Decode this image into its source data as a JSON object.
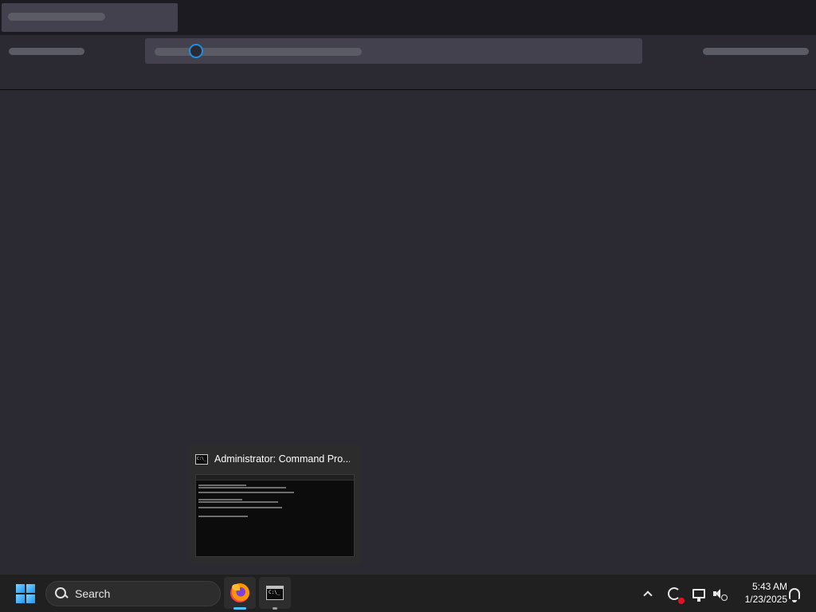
{
  "taskbar": {
    "search_label": "Search",
    "apps": [
      {
        "name": "Firefox",
        "icon": "firefox-icon",
        "active": true
      },
      {
        "name": "Command Prompt",
        "icon": "cmd-icon",
        "active": false
      }
    ],
    "clock": {
      "time": "5:43 AM",
      "date": "1/23/2025"
    },
    "tray_icons": [
      "chevron-up-icon",
      "sync-icon",
      "network-icon",
      "volume-icon",
      "bell-icon"
    ]
  },
  "preview": {
    "title": "Administrator: Command Pro..."
  },
  "colors": {
    "accent": "#4cc2ff",
    "spinner": "#1e8fe0",
    "taskbar_bg": "#202020",
    "page_bg": "#2b2a33"
  }
}
